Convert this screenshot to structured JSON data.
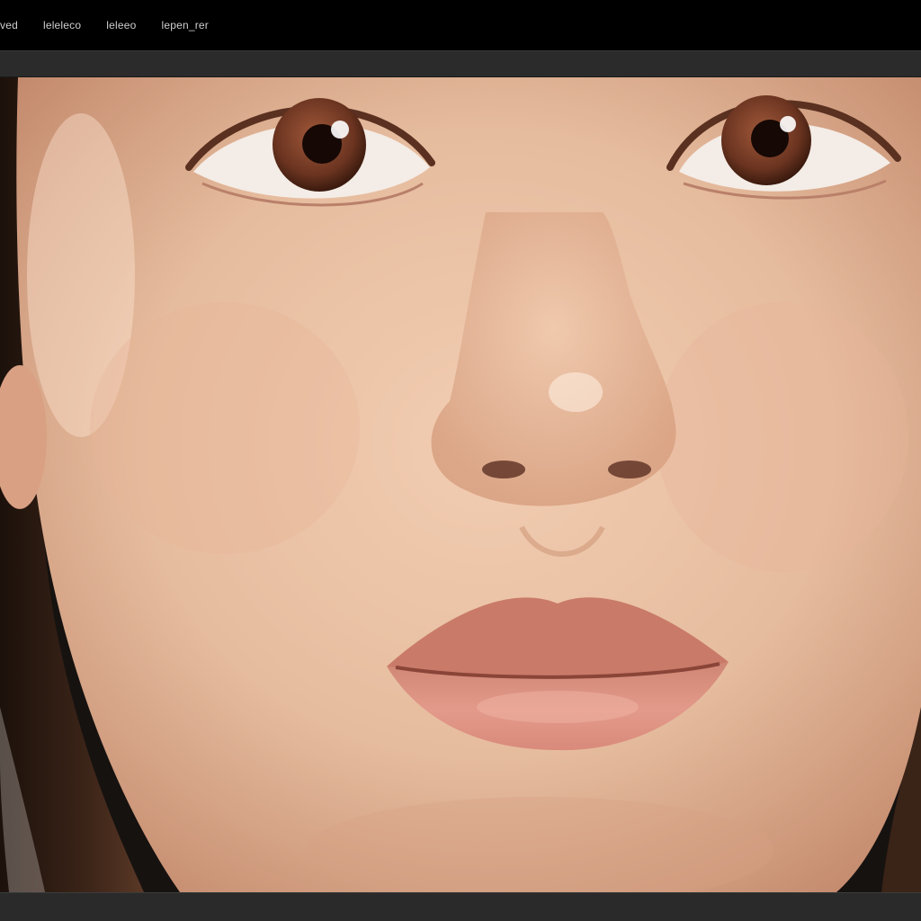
{
  "menubar": {
    "items": [
      {
        "label": "ved"
      },
      {
        "label": "leleleco"
      },
      {
        "label": "leleeo"
      },
      {
        "label": "lepen_rer"
      }
    ]
  },
  "canvas": {
    "content": "portrait-photo",
    "colors": {
      "skin": "#e6bc9e",
      "skin_shadow": "#c98f6e",
      "hair": "#2a1a12",
      "iris": "#6b3420",
      "lip": "#d98a7a",
      "background": "#111111"
    }
  }
}
